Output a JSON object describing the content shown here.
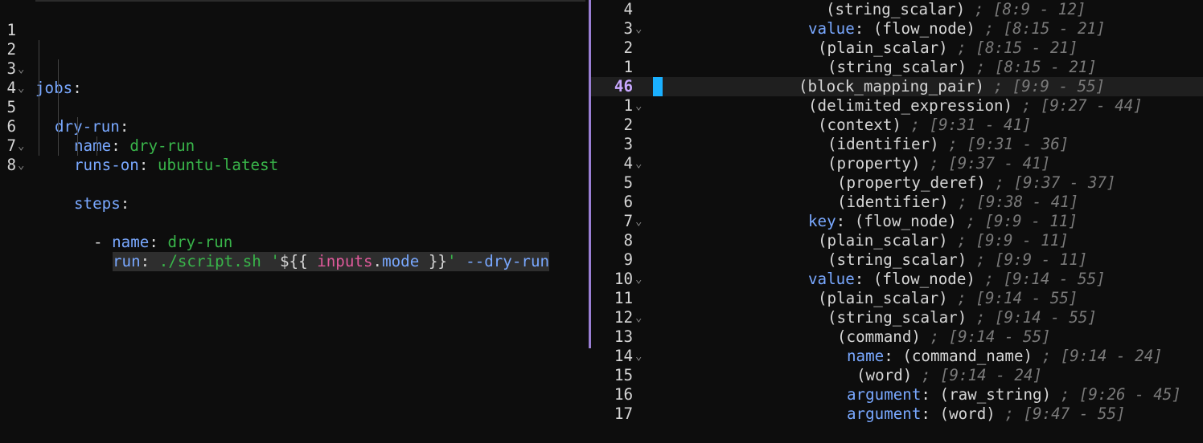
{
  "editor": {
    "lines": [
      {
        "num": "1",
        "fold": ""
      },
      {
        "num": "2",
        "fold": "⌄",
        "key": "jobs",
        "punct": ":"
      },
      {
        "num": "3",
        "fold": "⌄",
        "key": "dry-run",
        "punct": ":"
      },
      {
        "num": "4",
        "fold": "",
        "key": "name",
        "punct": ":",
        "val": "dry-run"
      },
      {
        "num": "5",
        "fold": "",
        "key": "runs-on",
        "punct": ":",
        "val": "ubuntu-latest"
      },
      {
        "num": "6",
        "fold": "⌄",
        "key": "steps",
        "punct": ":"
      },
      {
        "num": "7",
        "fold": "⌄",
        "dash": "- ",
        "key": "name",
        "punct": ":",
        "val": "dry-run"
      },
      {
        "num": "8",
        "fold": "",
        "key": "run",
        "punct": ":",
        "run_cmd": "./script.sh",
        "q_open": "'",
        "expr_open": "${{",
        "expr_ctx": "inputs",
        "expr_dot": ".",
        "expr_prop": "mode",
        "expr_close": "}}",
        "q_close": "'",
        "flag": "--dry-run"
      }
    ]
  },
  "tree": {
    "current_line_number": "46",
    "rows": [
      {
        "n": "4",
        "fold": "",
        "field": "",
        "node": "(string_scalar)",
        "range": "; [8:9 - 12]"
      },
      {
        "n": "3",
        "fold": "⌄",
        "field": "value",
        "node": "(flow_node)",
        "range": "; [8:15 - 21]"
      },
      {
        "n": "2",
        "fold": "",
        "field": "",
        "node": "(plain_scalar)",
        "range": "; [8:15 - 21]"
      },
      {
        "n": "1",
        "fold": "",
        "field": "",
        "node": "(string_scalar)",
        "range": "; [8:15 - 21]"
      },
      {
        "n": "46",
        "fold": "",
        "field": "",
        "node": "(block_mapping_pair)",
        "range": "; [9:9 - 55]"
      },
      {
        "n": "1",
        "fold": "⌄",
        "field": "",
        "node": "(delimited_expression)",
        "range": "; [9:27 - 44]"
      },
      {
        "n": "2",
        "fold": "",
        "field": "",
        "node": "(context)",
        "range": "; [9:31 - 41]"
      },
      {
        "n": "3",
        "fold": "",
        "field": "",
        "node": "(identifier)",
        "range": "; [9:31 - 36]"
      },
      {
        "n": "4",
        "fold": "⌄",
        "field": "",
        "node": "(property)",
        "range": "; [9:37 - 41]"
      },
      {
        "n": "5",
        "fold": "",
        "field": "",
        "node": "(property_deref)",
        "range": "; [9:37 - 37]"
      },
      {
        "n": "6",
        "fold": "",
        "field": "",
        "node": "(identifier)",
        "range": "; [9:38 - 41]"
      },
      {
        "n": "7",
        "fold": "⌄",
        "field": "key",
        "node": "(flow_node)",
        "range": "; [9:9 - 11]"
      },
      {
        "n": "8",
        "fold": "",
        "field": "",
        "node": "(plain_scalar)",
        "range": "; [9:9 - 11]"
      },
      {
        "n": "9",
        "fold": "",
        "field": "",
        "node": "(string_scalar)",
        "range": "; [9:9 - 11]"
      },
      {
        "n": "10",
        "fold": "⌄",
        "field": "value",
        "node": "(flow_node)",
        "range": "; [9:14 - 55]"
      },
      {
        "n": "11",
        "fold": "",
        "field": "",
        "node": "(plain_scalar)",
        "range": "; [9:14 - 55]"
      },
      {
        "n": "12",
        "fold": "⌄",
        "field": "",
        "node": "(string_scalar)",
        "range": "; [9:14 - 55]"
      },
      {
        "n": "13",
        "fold": "",
        "field": "",
        "node": "(command)",
        "range": "; [9:14 - 55]"
      },
      {
        "n": "14",
        "fold": "⌄",
        "field": "name",
        "node": "(command_name)",
        "range": "; [9:14 - 24]"
      },
      {
        "n": "15",
        "fold": "",
        "field": "",
        "node": "(word)",
        "range": "; [9:14 - 24]"
      },
      {
        "n": "16",
        "fold": "",
        "field": "argument",
        "node": "(raw_string)",
        "range": "; [9:26 - 45]"
      },
      {
        "n": "17",
        "fold": "",
        "field": "argument",
        "node": "(word)",
        "range": "; [9:47 - 55]"
      }
    ]
  },
  "colors": {
    "key": "#79a8ff",
    "string": "#39b54a",
    "comment": "#7a7a7a",
    "expression": "#e05a9b",
    "divider": "#9a7fd4",
    "cursor": "#1ab0ff"
  }
}
